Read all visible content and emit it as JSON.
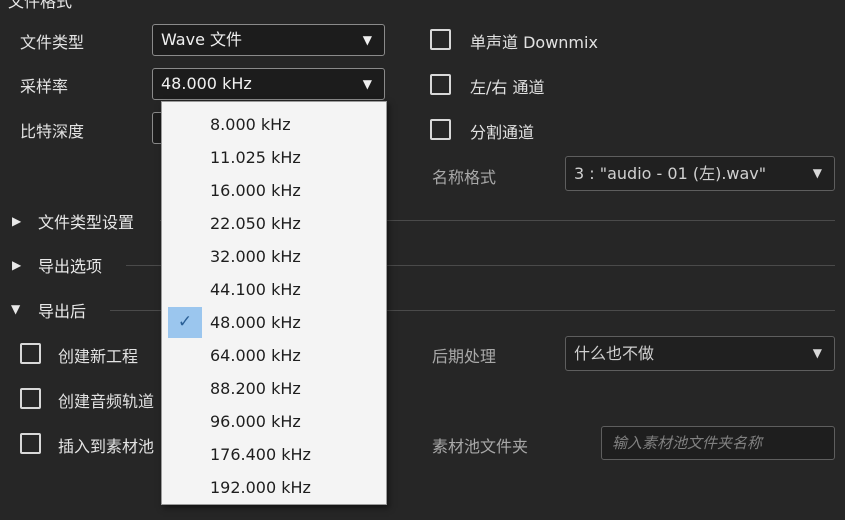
{
  "section_file_format": {
    "title": "文件格式"
  },
  "file_type": {
    "label": "文件类型",
    "value": "Wave 文件"
  },
  "sample_rate": {
    "label": "采样率",
    "value": "48.000 kHz",
    "options": [
      "8.000 kHz",
      "11.025 kHz",
      "16.000 kHz",
      "22.050 kHz",
      "32.000 kHz",
      "44.100 kHz",
      "48.000 kHz",
      "64.000 kHz",
      "88.200 kHz",
      "96.000 kHz",
      "176.400 kHz",
      "192.000 kHz"
    ],
    "selected_index": 6,
    "check_glyph": "✓"
  },
  "bit_depth": {
    "label": "比特深度"
  },
  "options_right": {
    "mono_downmix": "单声道 Downmix",
    "lr_channels": "左/右 通道",
    "split_channels": "分割通道",
    "name_format_label": "名称格式",
    "name_format_value": "3 : \"audio - 01 (左).wav\""
  },
  "sections": {
    "file_type_settings": "文件类型设置",
    "export_options": "导出选项",
    "after_export": "导出后"
  },
  "after_export": {
    "create_project": "创建新工程",
    "create_audio_track": "创建音频轨道",
    "insert_pool": "插入到素材池",
    "post_process_label": "后期处理",
    "post_process_value": "什么也不做",
    "pool_folder_label": "素材池文件夹",
    "pool_folder_placeholder": "输入素材池文件夹名称"
  },
  "colors": {
    "background": "#262626",
    "dropdown_bg": "#f4f4f4",
    "selection": "#9bc6ee"
  }
}
